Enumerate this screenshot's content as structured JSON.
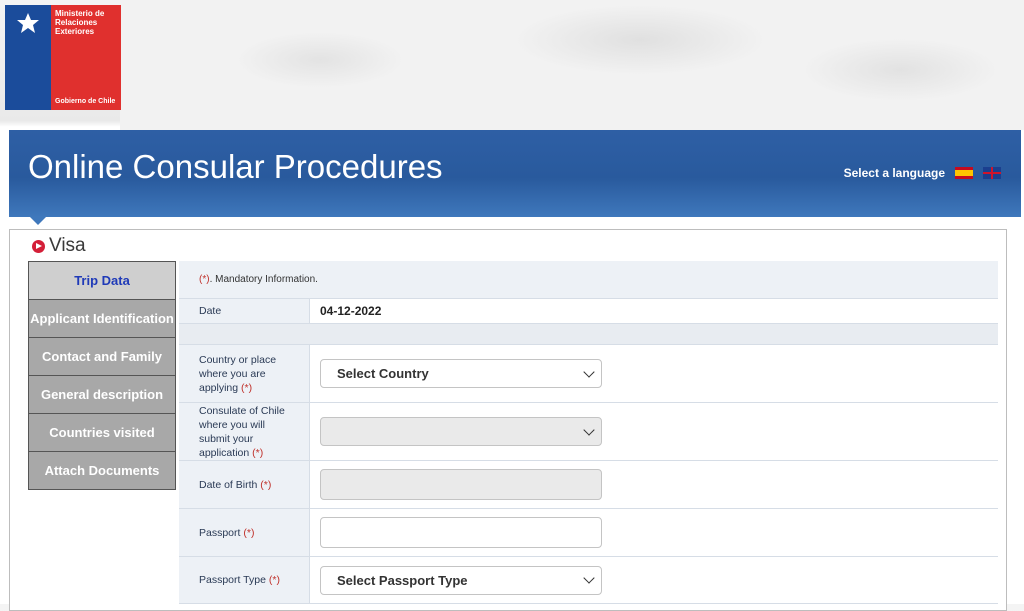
{
  "logo": {
    "line1": "Ministerio de",
    "line2": "Relaciones",
    "line3": "Exteriores",
    "footer": "Gobierno de Chile"
  },
  "header": {
    "title": "Online Consular Procedures",
    "language_label": "Select a language",
    "flags": [
      "spain-flag-icon",
      "uk-flag-icon"
    ]
  },
  "section": {
    "title": "Visa"
  },
  "nav": {
    "items": [
      {
        "label": "Trip Data",
        "active": true
      },
      {
        "label": "Applicant Identification"
      },
      {
        "label": "Contact and Family"
      },
      {
        "label": "General description"
      },
      {
        "label": "Countries visited"
      },
      {
        "label": "Attach Documents"
      }
    ]
  },
  "form": {
    "mandatory_marker": "(*)",
    "mandatory_text": ". Mandatory Information.",
    "date_label": "Date",
    "date_value": "04-12-2022",
    "country_label": "Country or place where you are applying",
    "country_select": "Select Country",
    "consulate_label": "Consulate of Chile where you will submit your application",
    "consulate_select": "",
    "dob_label": "Date of Birth",
    "passport_label": "Passport",
    "passport_value": "",
    "passport_type_label": "Passport Type",
    "passport_type_select": "Select Passport Type",
    "req": "(*)"
  },
  "colors": {
    "header_blue": "#2e5fa5",
    "logo_red": "#e0302e",
    "logo_blue": "#1b4c9b",
    "active_nav_text": "#1f3ab8"
  }
}
